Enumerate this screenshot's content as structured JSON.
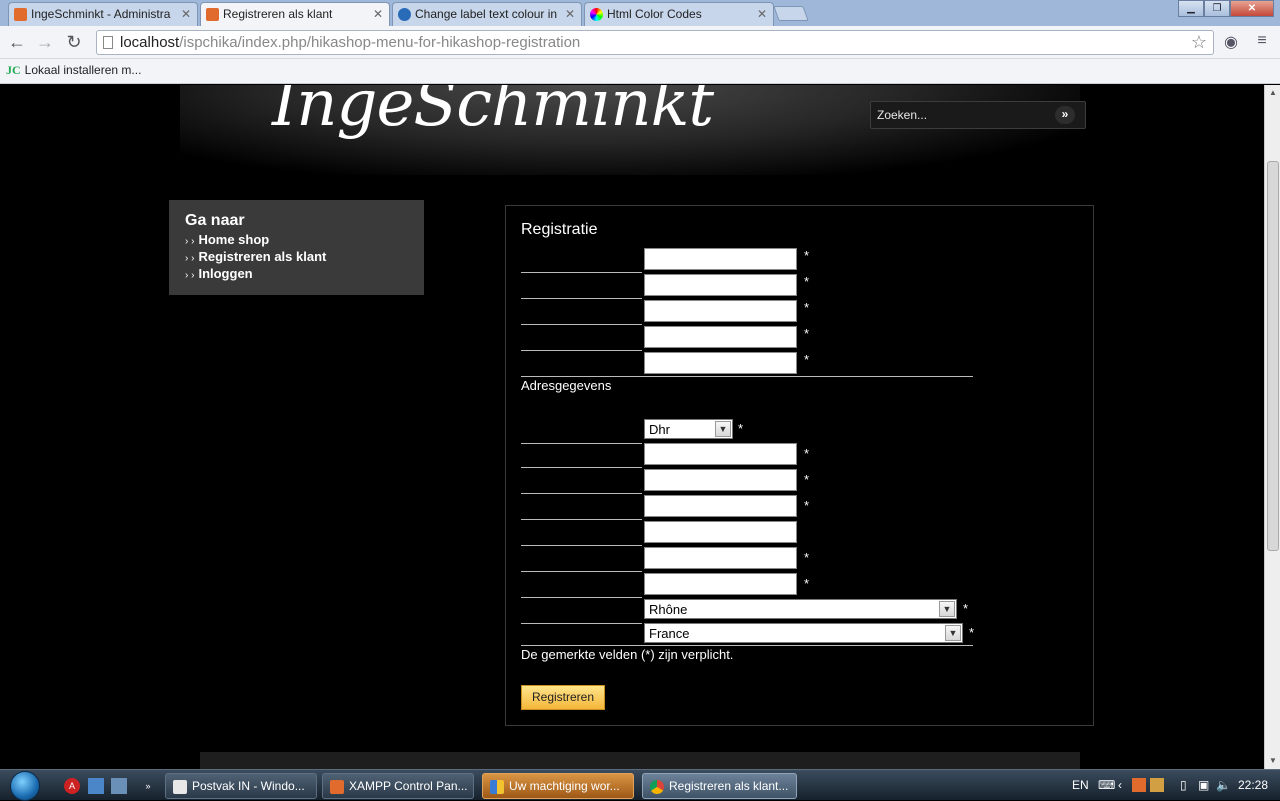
{
  "browser": {
    "tabs": [
      {
        "label": "IngeSchminkt - Administra",
        "active": false
      },
      {
        "label": "Registreren als klant",
        "active": true
      },
      {
        "label": "Change label text colour in",
        "active": false
      },
      {
        "label": "Html Color Codes",
        "active": false
      }
    ],
    "url_host": "localhost",
    "url_path": "/ispchika/index.php/hikashop-menu-for-hikashop-registration",
    "bookmark": "Lokaal installeren m...",
    "bookmark_logo": "JC"
  },
  "site": {
    "logo": "IngeSchminkt",
    "search_placeholder": "Zoeken...",
    "search_go": "»"
  },
  "sidebar": {
    "title": "Ga naar",
    "items": [
      {
        "label": "Home shop"
      },
      {
        "label": "Registreren als klant"
      },
      {
        "label": "Inloggen"
      }
    ]
  },
  "form": {
    "title": "Registratie",
    "section": "Adresgegevens",
    "title_select": "Dhr",
    "state_select": "Rhône",
    "country_select": "France",
    "required_note": "De gemerkte velden (*) zijn verplicht.",
    "submit_label": "Registreren",
    "required_mark": "*"
  },
  "taskbar": {
    "buttons": [
      {
        "label": "Postvak IN - Windo..."
      },
      {
        "label": "XAMPP Control Pan..."
      },
      {
        "label": "Uw machtiging wor..."
      },
      {
        "label": "Registreren als klant..."
      }
    ],
    "language": "EN",
    "clock": "22:28"
  },
  "colors": {
    "page_bg": "#000000",
    "button_accent": "#f4b63a",
    "sidebar_bg": "#3a3a3a"
  }
}
